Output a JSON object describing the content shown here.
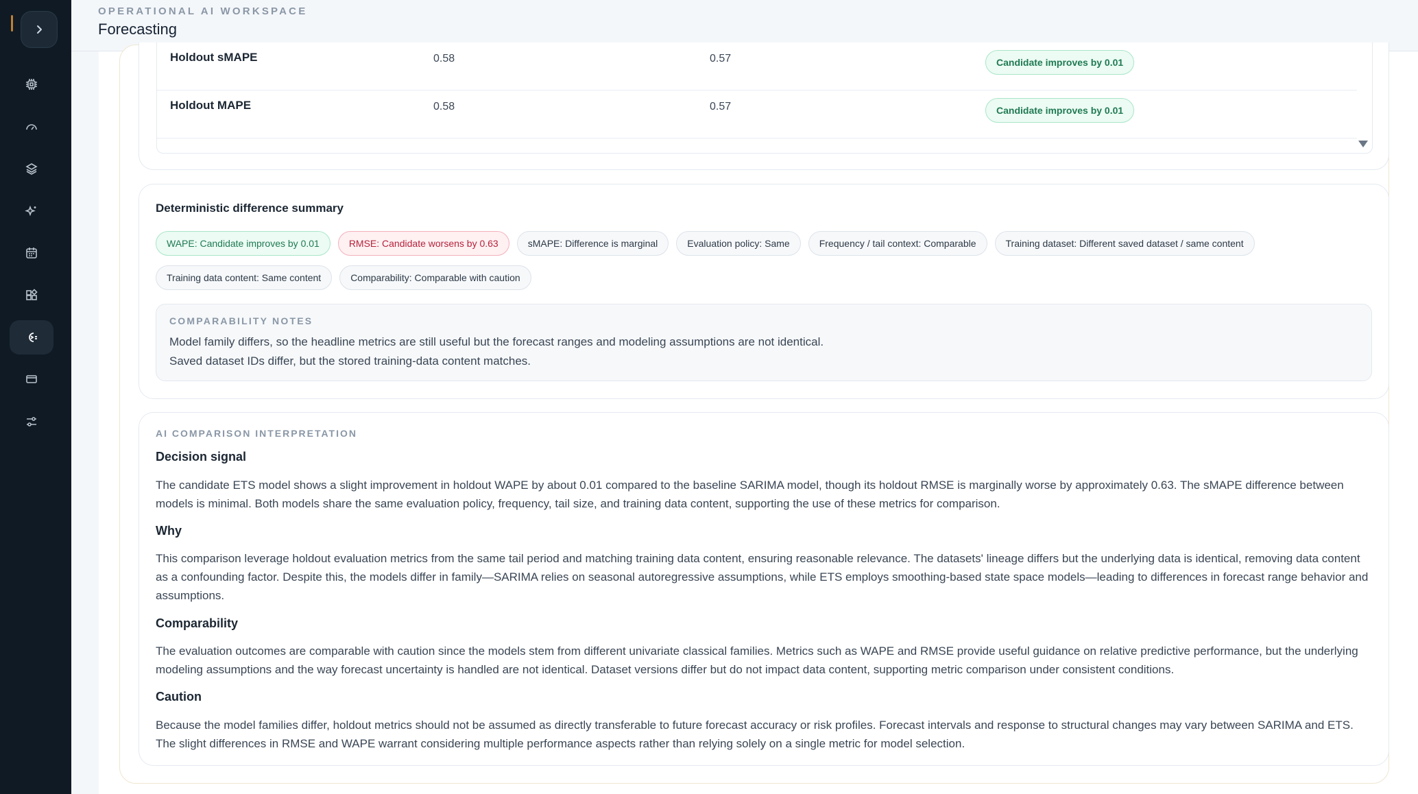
{
  "header": {
    "eyebrow": "OPERATIONAL AI WORKSPACE",
    "title": "Forecasting"
  },
  "sidebar": {
    "toggle_icon": "chevron-right-icon",
    "items": [
      {
        "icon": "cpu-icon",
        "active": false
      },
      {
        "icon": "gauge-icon",
        "active": false
      },
      {
        "icon": "layers-icon",
        "active": false
      },
      {
        "icon": "sparkles-icon",
        "active": false
      },
      {
        "icon": "calendar-icon",
        "active": false
      },
      {
        "icon": "widgets-icon",
        "active": false
      },
      {
        "icon": "compare-icon",
        "active": true
      },
      {
        "icon": "card-icon",
        "active": false
      },
      {
        "icon": "sliders-icon",
        "active": false
      }
    ]
  },
  "metrics_table": {
    "rows": [
      {
        "metric": "Holdout sMAPE",
        "baseline": "0.58",
        "candidate": "0.57",
        "verdict": "Candidate improves by 0.01"
      },
      {
        "metric": "Holdout MAPE",
        "baseline": "0.58",
        "candidate": "0.57",
        "verdict": "Candidate improves by 0.01"
      }
    ]
  },
  "difference_summary": {
    "title": "Deterministic difference summary",
    "chips_row1": [
      {
        "label": "WAPE: Candidate improves by 0.01",
        "tone": "green"
      },
      {
        "label": "RMSE: Candidate worsens by 0.63",
        "tone": "red"
      },
      {
        "label": "sMAPE: Difference is marginal",
        "tone": "neutral"
      },
      {
        "label": "Evaluation policy: Same",
        "tone": "neutral"
      },
      {
        "label": "Frequency / tail context: Comparable",
        "tone": "neutral"
      },
      {
        "label": "Training dataset: Different saved dataset / same content",
        "tone": "neutral"
      }
    ],
    "chips_row2": [
      {
        "label": "Training data content: Same content",
        "tone": "neutral"
      },
      {
        "label": "Comparability: Comparable with caution",
        "tone": "neutral"
      }
    ],
    "notes_label": "COMPARABILITY NOTES",
    "notes": [
      "Model family differs, so the headline metrics are still useful but the forecast ranges and modeling assumptions are not identical.",
      "Saved dataset IDs differ, but the stored training-data content matches."
    ]
  },
  "ai_interpretation": {
    "label": "AI COMPARISON INTERPRETATION",
    "sections": [
      {
        "heading": "Decision signal",
        "text": "The candidate ETS model shows a slight improvement in holdout WAPE by about 0.01 compared to the baseline SARIMA model, though its holdout RMSE is marginally worse by approximately 0.63. The sMAPE difference between models is minimal. Both models share the same evaluation policy, frequency, tail size, and training data content, supporting the use of these metrics for comparison."
      },
      {
        "heading": "Why",
        "text": "This comparison leverage holdout evaluation metrics from the same tail period and matching training data content, ensuring reasonable relevance. The datasets' lineage differs but the underlying data is identical, removing data content as a confounding factor. Despite this, the models differ in family—SARIMA relies on seasonal autoregressive assumptions, while ETS employs smoothing-based state space models—leading to differences in forecast range behavior and assumptions."
      },
      {
        "heading": "Comparability",
        "text": "The evaluation outcomes are comparable with caution since the models stem from different univariate classical families. Metrics such as WAPE and RMSE provide useful guidance on relative predictive performance, but the underlying modeling assumptions and the way forecast uncertainty is handled are not identical. Dataset versions differ but do not impact data content, supporting metric comparison under consistent conditions."
      },
      {
        "heading": "Caution",
        "text": "Because the model families differ, holdout metrics should not be assumed as directly transferable to future forecast accuracy or risk profiles. Forecast intervals and response to structural changes may vary between SARIMA and ETS. The slight differences in RMSE and WAPE warrant considering multiple performance aspects rather than relying solely on a single metric for model selection."
      }
    ]
  }
}
